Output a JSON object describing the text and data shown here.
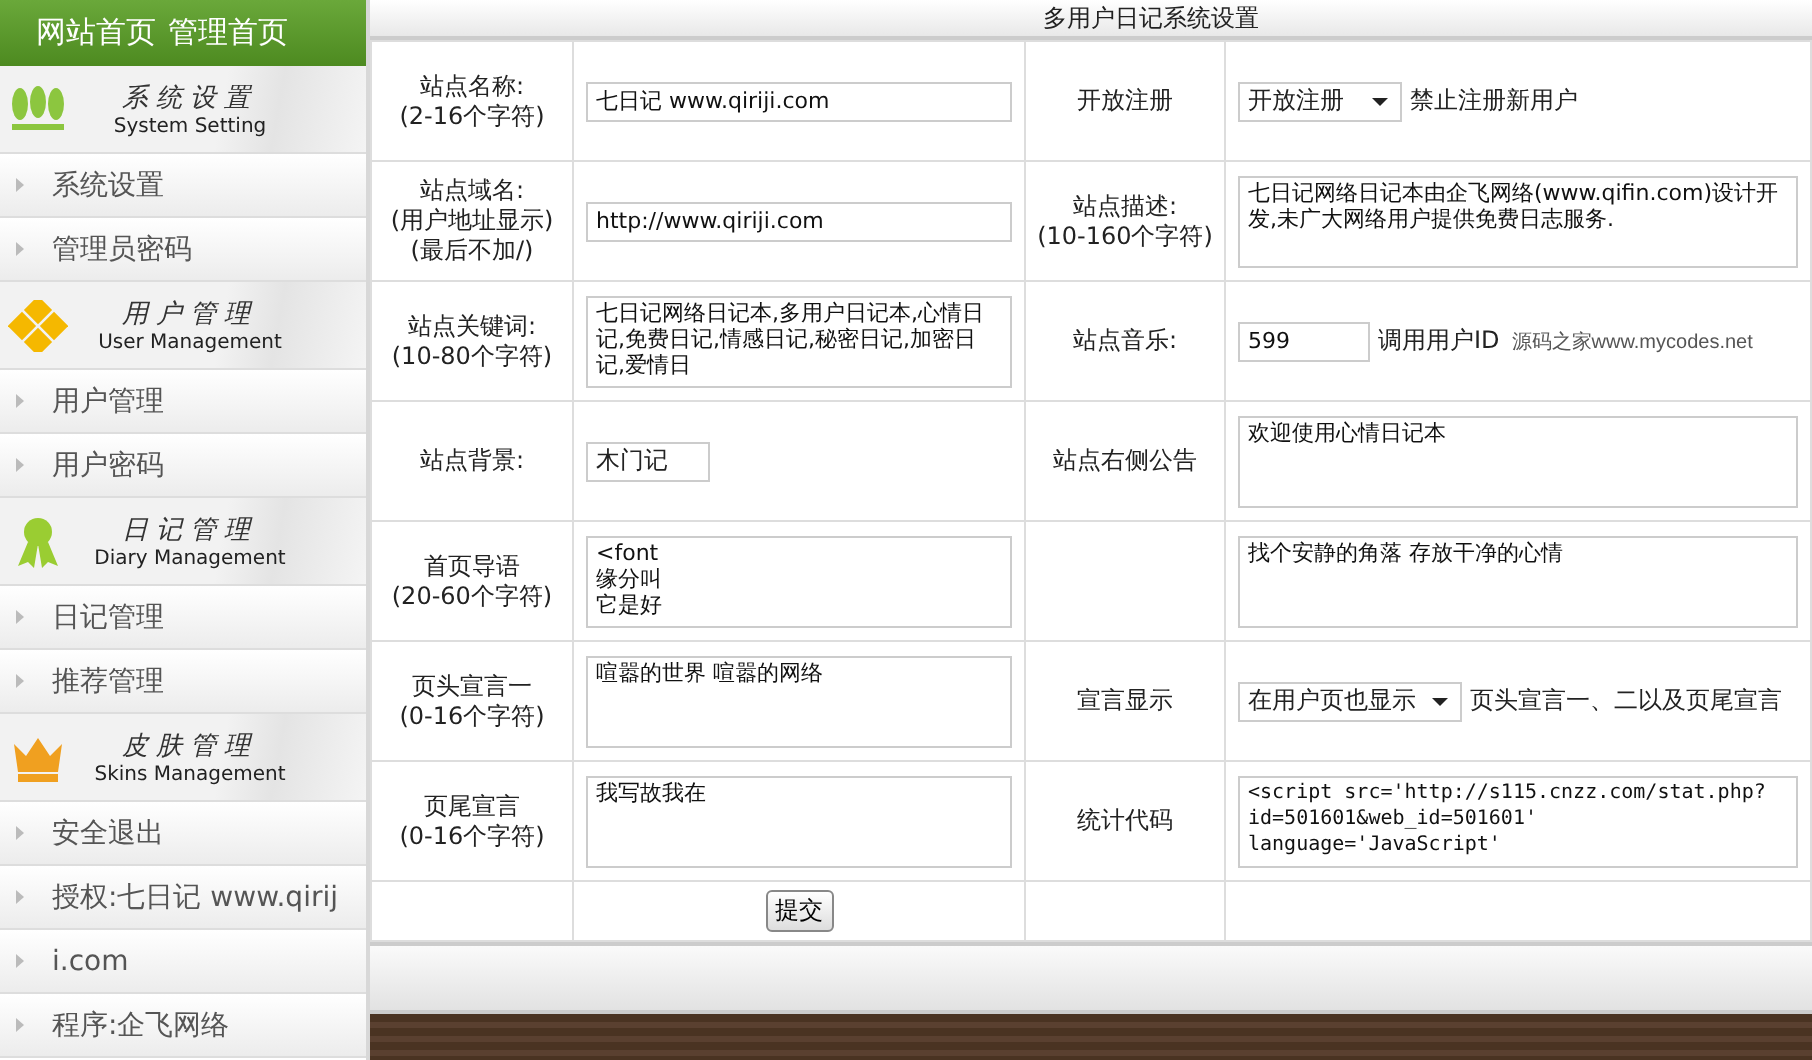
{
  "sidebar": {
    "header_links": [
      "网站首页",
      "管理首页"
    ],
    "sections": [
      {
        "title": "系统设置",
        "subtitle": "System Setting",
        "items": [
          "系统设置",
          "管理员密码"
        ]
      },
      {
        "title": "用户管理",
        "subtitle": "User Management",
        "items": [
          "用户管理",
          "用户密码"
        ]
      },
      {
        "title": "日记管理",
        "subtitle": "Diary Management",
        "items": [
          "日记管理",
          "推荐管理"
        ]
      },
      {
        "title": "皮肤管理",
        "subtitle": "Skins Management",
        "items": [
          "安全退出",
          "授权:七日记 www.qirij",
          "i.com",
          "程序:企飞网络"
        ]
      }
    ]
  },
  "main": {
    "title": "多用户日记系统设置",
    "rows": [
      {
        "left": {
          "label": "站点名称:",
          "hints": [
            "(2-16个字符)"
          ],
          "field": {
            "kind": "input",
            "value": "七日记 www.qiriji.com"
          }
        },
        "right": {
          "label": "开放注册",
          "field": {
            "kind": "select",
            "value": "开放注册",
            "note": "禁止注册新用户"
          }
        }
      },
      {
        "left": {
          "label": "站点域名:",
          "hints": [
            "(用户地址显示)",
            "(最后不加/)"
          ],
          "field": {
            "kind": "input",
            "value": "http://www.qiriji.com"
          }
        },
        "right": {
          "label": "站点描述:",
          "hints": [
            "(10-160个字符)"
          ],
          "field": {
            "kind": "textarea",
            "value": "七日记网络日记本由企飞网络(www.qifin.com)设计开发,未广大网络用户提供免费日志服务."
          }
        }
      },
      {
        "left": {
          "label": "站点关键词:",
          "hints": [
            "(10-80个字符)"
          ],
          "field": {
            "kind": "textarea",
            "value": "七日记网络日记本,多用户日记本,心情日记,免费日记,情感日记,秘密日记,加密日记,爱情日"
          }
        },
        "right": {
          "label": "站点音乐:",
          "field": {
            "kind": "short_input",
            "value": "599",
            "note": "调用用户ID",
            "extra": "源码之家www.mycodes.net"
          }
        }
      },
      {
        "left": {
          "label": "站点背景:",
          "field": {
            "kind": "small_select",
            "value": "木门记"
          }
        },
        "right": {
          "label": "站点右侧公告",
          "field": {
            "kind": "textarea",
            "value": "欢迎使用心情日记本"
          }
        }
      },
      {
        "left": {
          "label": "首页导语",
          "hints": [
            "(20-60个字符)"
          ],
          "field": {
            "kind": "lines",
            "lines": [
              "<font",
              "缘分叫",
              "它是好"
            ]
          }
        },
        "right": {
          "field": {
            "kind": "textarea",
            "value": "找个安静的角落 存放干净的心情"
          }
        }
      },
      {
        "left": {
          "label": "页头宣言一",
          "hints": [
            "(0-16个字符)"
          ],
          "field": {
            "kind": "textarea",
            "value": "喧嚣的世界 喧嚣的网络"
          }
        },
        "right": {
          "label": "宣言显示",
          "field": {
            "kind": "select",
            "value": "在用户页也显示",
            "note": "页头宣言一、二以及页尾宣言"
          }
        }
      },
      {
        "left": {
          "label": "页尾宣言",
          "hints": [
            "(0-16个字符)"
          ],
          "field": {
            "kind": "textarea",
            "value": "我写故我在"
          }
        },
        "right": {
          "label": "统计代码",
          "field": {
            "kind": "code",
            "value": "<script src='http://s115.cnzz.com/stat.php?id=501601&web_id=501601' language='JavaScript'"
          }
        }
      }
    ],
    "submit": "提交"
  }
}
